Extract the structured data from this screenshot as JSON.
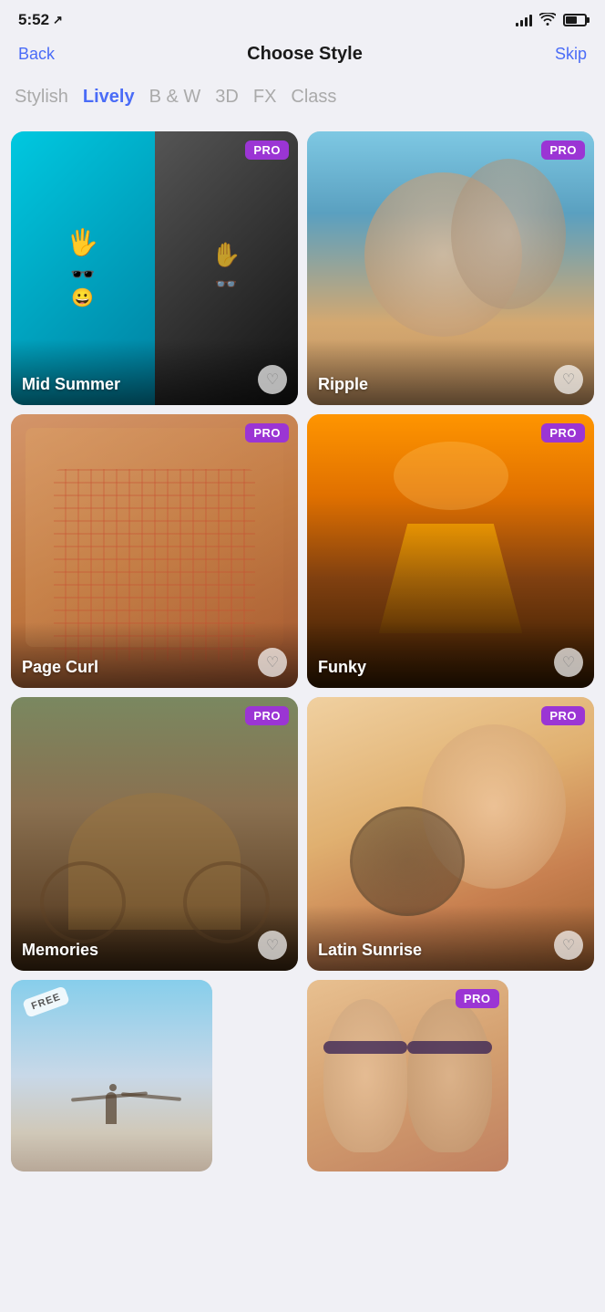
{
  "statusBar": {
    "time": "5:52",
    "locationIcon": "↗"
  },
  "header": {
    "back": "Back",
    "title": "Choose Style",
    "skip": "Skip"
  },
  "tabs": [
    {
      "id": "stylish",
      "label": "Stylish",
      "active": false
    },
    {
      "id": "lively",
      "label": "Lively",
      "active": true
    },
    {
      "id": "bw",
      "label": "B & W",
      "active": false
    },
    {
      "id": "3d",
      "label": "3D",
      "active": false
    },
    {
      "id": "fx",
      "label": "FX",
      "active": false
    },
    {
      "id": "class",
      "label": "Class",
      "active": false,
      "partial": true
    }
  ],
  "colors": {
    "accent": "#4a6cf7",
    "pro": "#9b35d4",
    "activeTab": "#4a6cf7",
    "inactiveTab": "#aaaaaa"
  },
  "cards": [
    {
      "id": "mid-summer",
      "name": "Mid Summer",
      "badge": "PRO",
      "bgClass": "bg-mid-summer",
      "heart": "♡"
    },
    {
      "id": "ripple",
      "name": "Ripple",
      "badge": "PRO",
      "bgClass": "bg-ripple",
      "heart": "♡"
    },
    {
      "id": "page-curl",
      "name": "Page Curl",
      "badge": "PRO",
      "bgClass": "bg-page-curl",
      "heart": "♡"
    },
    {
      "id": "funky",
      "name": "Funky",
      "badge": "PRO",
      "bgClass": "bg-funky",
      "heart": "♡"
    },
    {
      "id": "memories",
      "name": "Memories",
      "badge": "PRO",
      "bgClass": "bg-memories",
      "heart": "♡"
    },
    {
      "id": "latin-sunrise",
      "name": "Latin Sunrise",
      "badge": "PRO",
      "bgClass": "bg-latin-sunrise",
      "heart": "♡"
    },
    {
      "id": "free-item",
      "name": "",
      "badge": "FREE",
      "bgClass": "bg-free-item",
      "heart": ""
    },
    {
      "id": "last-item",
      "name": "",
      "badge": "PRO",
      "bgClass": "bg-last-item",
      "heart": ""
    }
  ]
}
